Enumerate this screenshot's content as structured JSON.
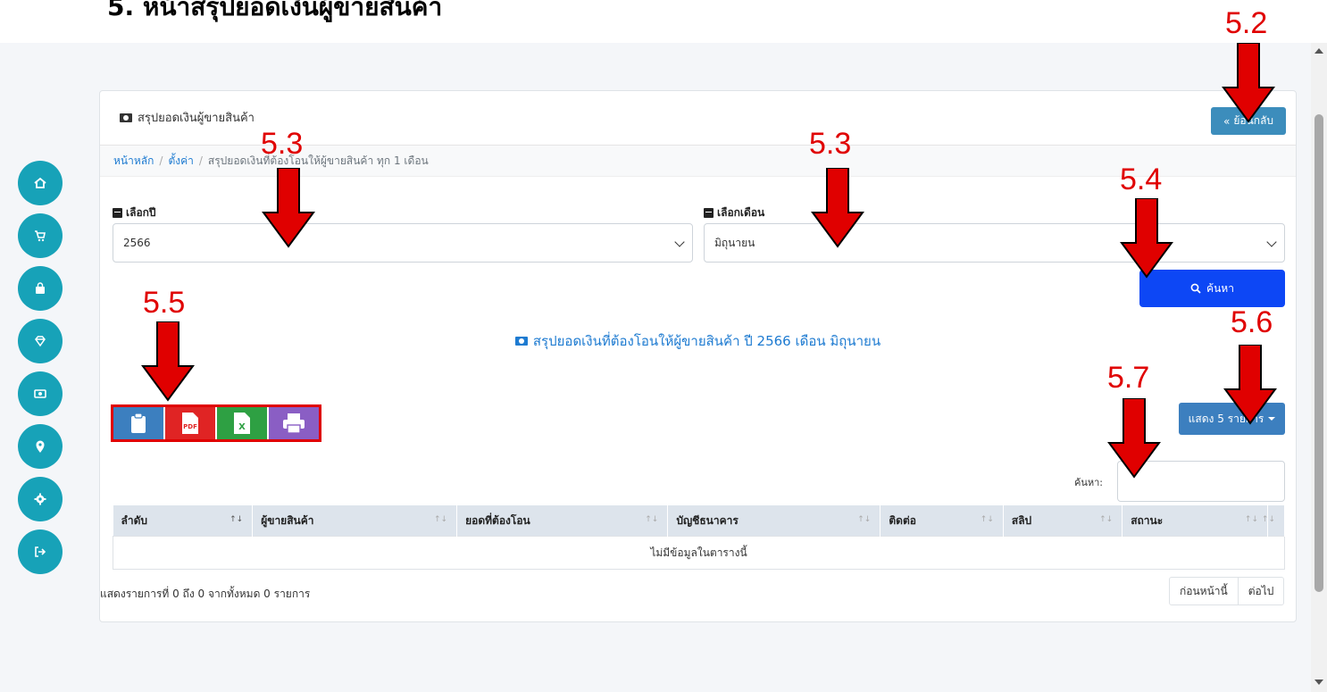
{
  "document": {
    "title": "5. หน้าสรุปยอดเงินผู้ขายสินค้า"
  },
  "sidebar": {
    "items": [
      {
        "name": "home",
        "icon": "home-icon"
      },
      {
        "name": "cart",
        "icon": "cart-icon"
      },
      {
        "name": "shopping-bag",
        "icon": "shopping-bag-icon"
      },
      {
        "name": "gem",
        "icon": "gem-icon"
      },
      {
        "name": "money",
        "icon": "money-icon"
      },
      {
        "name": "location",
        "icon": "location-pin-icon"
      },
      {
        "name": "settings",
        "icon": "gear-icon"
      },
      {
        "name": "logout",
        "icon": "logout-icon"
      }
    ],
    "color": "#17a2b8"
  },
  "header": {
    "title": "สรุปยอดเงินผู้ขายสินค้า",
    "back_label": "ย้อนกลับ"
  },
  "breadcrumb": {
    "items": [
      "หน้าหลัก",
      "ตั้งค่า",
      "สรุปยอดเงินที่ต้องโอนให้ผู้ขายสินค้า ทุก 1 เดือน"
    ]
  },
  "filters": {
    "year_label": "เลือกปี",
    "year_value": "2566",
    "month_label": "เลือกเดือน",
    "month_value": "มิถุนายน",
    "search_button": "ค้นหา"
  },
  "summary": {
    "heading": "สรุปยอดเงินที่ต้องโอนให้ผู้ขายสินค้า ปี 2566 เดือน มิถุนายน"
  },
  "export_buttons": [
    {
      "name": "copy",
      "icon": "clipboard-icon",
      "color": "#3c7fbf"
    },
    {
      "name": "pdf",
      "icon": "pdf-icon",
      "color": "#e02424",
      "icon_text": "PDF"
    },
    {
      "name": "excel",
      "icon": "excel-icon",
      "color": "#2ea043",
      "icon_text": "X"
    },
    {
      "name": "print",
      "icon": "printer-icon",
      "color": "#8a5ec4"
    }
  ],
  "table_controls": {
    "show_entries": "แสดง 5 รายการ",
    "search_label": "ค้นหา:"
  },
  "table": {
    "columns": [
      "ลำดับ",
      "ผู้ขายสินค้า",
      "ยอดที่ต้องโอน",
      "บัญชีธนาคาร",
      "ติดต่อ",
      "สลิป",
      "สถานะ",
      ""
    ],
    "empty_message": "ไม่มีข้อมูลในตารางนี้"
  },
  "footer": {
    "info": "แสดงรายการที่ 0 ถึง 0 จากทั้งหมด 0 รายการ",
    "prev": "ก่อนหน้านี้",
    "next": "ต่อไป"
  },
  "annotations": [
    {
      "label": "5.2"
    },
    {
      "label": "5.3"
    },
    {
      "label": "5.3"
    },
    {
      "label": "5.4"
    },
    {
      "label": "5.5"
    },
    {
      "label": "5.6"
    },
    {
      "label": "5.7"
    }
  ],
  "colors": {
    "primary": "#3c8dbc",
    "search_button": "#0d47f5",
    "link": "#1e7bd1",
    "annotation": "#e00000"
  }
}
